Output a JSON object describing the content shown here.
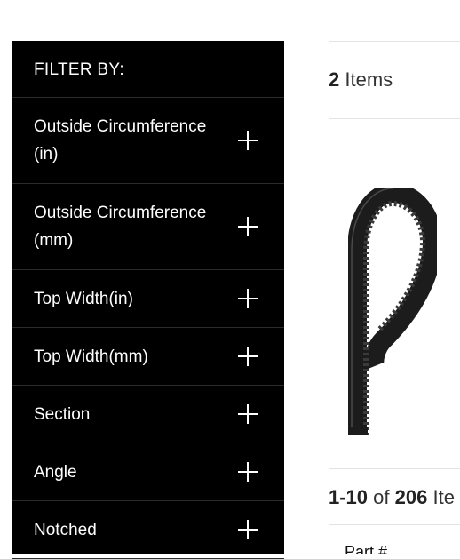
{
  "sidebar": {
    "header": "FILTER BY:",
    "filters": [
      {
        "label": "Outside Circumference (in)"
      },
      {
        "label": "Outside Circumference (mm)"
      },
      {
        "label": "Top Width(in)"
      },
      {
        "label": "Top Width(mm)"
      },
      {
        "label": "Section"
      },
      {
        "label": "Angle"
      },
      {
        "label": "Notched"
      }
    ]
  },
  "results": {
    "count": "2",
    "count_label": "Items",
    "range": "1-10",
    "of": "of",
    "total": "206",
    "total_label": "Ite",
    "sort_label": "Part #"
  },
  "icons": [
    "plus-icon",
    "belt-product-image"
  ],
  "colors": {
    "sidebar_bg": "#000000",
    "sidebar_text": "#ffffff",
    "divider": "#2b2b2b"
  }
}
